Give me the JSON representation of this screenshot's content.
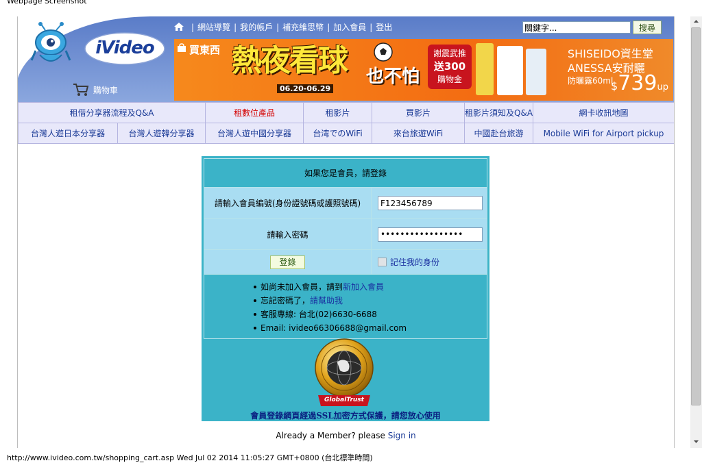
{
  "caption": "Webpage Screenshot",
  "header": {
    "brand": "iVideo",
    "cart_label": "購物車",
    "nav_links": [
      "網站導覽",
      "我的帳戶",
      "補充維思幣",
      "加入會員",
      "登出"
    ],
    "search": {
      "value": "關鍵字...",
      "button": "搜尋"
    }
  },
  "banner": {
    "shop": "買東西",
    "headline": "熱夜看球",
    "headline_tail": "也不怕",
    "dates": "06.20-06.29",
    "promo_lines": [
      "謝震武推",
      "送300",
      "購物金"
    ],
    "brand_line1": "SHISEIDO資生堂",
    "brand_line2": "ANESSA安耐曬",
    "product": "防曬露60ml",
    "price_symbol": "$",
    "price": "739",
    "price_suffix": "up"
  },
  "nav_rows": [
    [
      "租借分享器流程及Q&A",
      "租數位產品",
      "租影片",
      "買影片",
      "租影片須知及Q&A",
      "網卡收訊地圖"
    ],
    [
      "台灣人遊日本分享器",
      "台灣人遊韓分享器",
      "台灣人遊中國分享器",
      "台湾でのWiFi",
      "來台旅遊WiFi",
      "中國赴台旅游",
      "Mobile WiFi for Airport pickup"
    ]
  ],
  "login": {
    "title": "如果您是會員，請登錄",
    "id_label": "請輸入會員編號(身份證號碼或護照號碼)",
    "id_value": "F123456789",
    "pw_label": "請輸入密碼",
    "pw_value": "•••••••••••••••••",
    "submit": "登錄",
    "remember": "記住我的身份",
    "info": {
      "join_prefix": "如尚未加入會員，請到",
      "join_link": "新加入會員",
      "forgot_prefix": "忘記密碼了，",
      "forgot_link": "請幫助我",
      "service": "客服專線: 台北(02)6630-6688",
      "email": "Email: ivideo66306688@gmail.com"
    },
    "seal_brand": "GlobalTrust",
    "ssl_note": "會員登錄網頁經過SSL加密方式保護，請您放心使用"
  },
  "already": {
    "text": "Already a Member? please",
    "link": "Sign in"
  },
  "statusbar": "http://www.ivideo.com.tw/shopping_cart.asp Wed Jul 02 2014 11:05:27 GMT+0800 (台北標準時間)",
  "colors": {
    "header_blue": "#6f8fd0",
    "login_teal": "#3bb3c8",
    "nav_bg": "#e8e8fa",
    "banner_orange": "#f27b17"
  }
}
